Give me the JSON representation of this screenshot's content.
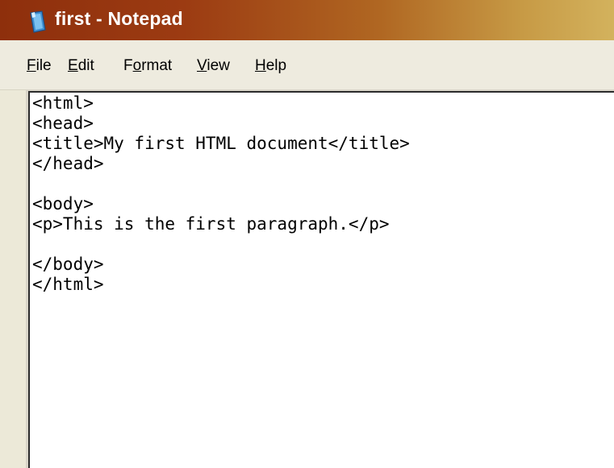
{
  "window": {
    "title": "first - Notepad",
    "icon": "notepad-icon"
  },
  "menu": {
    "items": [
      {
        "mnemonic": "F",
        "rest": "ile",
        "name": "menu-file"
      },
      {
        "mnemonic": "E",
        "rest": "dit",
        "name": "menu-edit"
      },
      {
        "pre": "F",
        "mnemonic": "o",
        "rest": "rmat",
        "name": "menu-format"
      },
      {
        "mnemonic": "V",
        "rest": "iew",
        "name": "menu-view"
      },
      {
        "mnemonic": "H",
        "rest": "elp",
        "name": "menu-help"
      }
    ]
  },
  "editor": {
    "lines": [
      "<html>",
      "<head>",
      "<title>My first HTML document</title>",
      "</head>",
      "",
      "<body>",
      "<p>This is the first paragraph.</p>",
      "",
      "</body>",
      "</html>"
    ]
  },
  "colors": {
    "titlebar_start": "#8e2f0c",
    "titlebar_end": "#d3b25d",
    "menubar": "#eeebdf",
    "editor_background": "#ffffff"
  }
}
